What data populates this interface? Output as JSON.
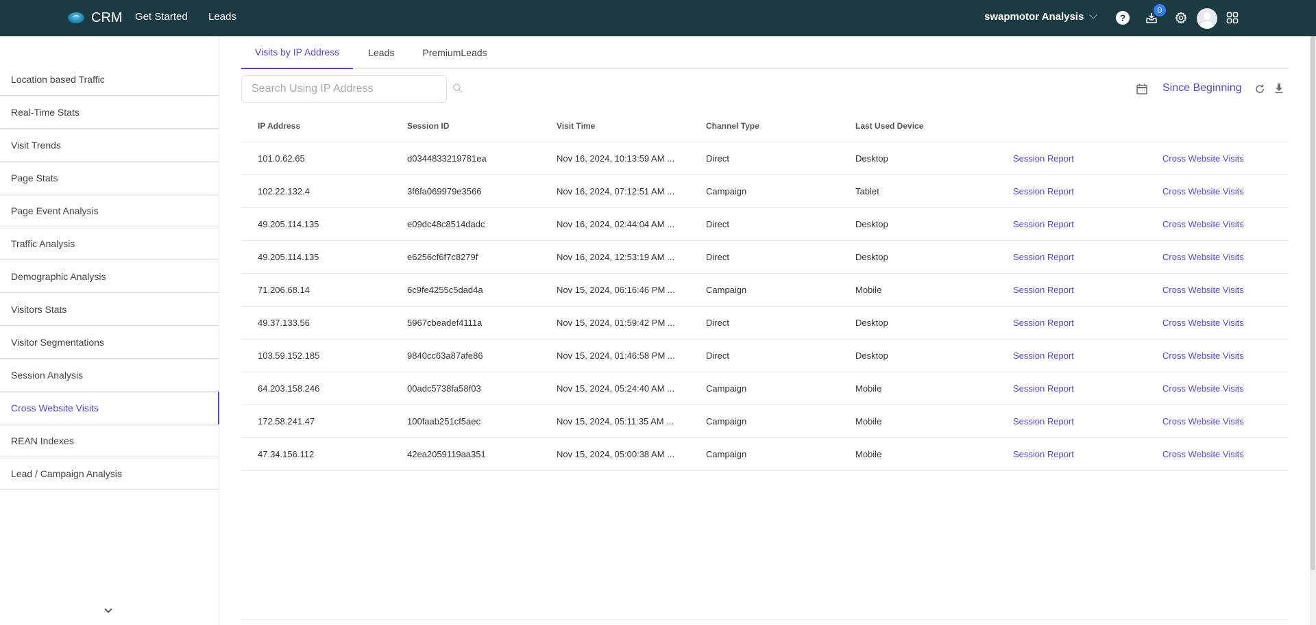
{
  "topbar": {
    "brand": "CRM",
    "nav": [
      "Get Started",
      "Leads"
    ],
    "org_name": "swapmotor Analysis",
    "inbox_count": "0",
    "help_glyph": "?"
  },
  "sidebar": {
    "items": [
      {
        "label": "Location based Traffic",
        "active": false
      },
      {
        "label": "Real-Time Stats",
        "active": false
      },
      {
        "label": "Visit Trends",
        "active": false
      },
      {
        "label": "Page Stats",
        "active": false
      },
      {
        "label": "Page Event Analysis",
        "active": false
      },
      {
        "label": "Traffic Analysis",
        "active": false
      },
      {
        "label": "Demographic Analysis",
        "active": false
      },
      {
        "label": "Visitors Stats",
        "active": false
      },
      {
        "label": "Visitor Segmentations",
        "active": false
      },
      {
        "label": "Session Analysis",
        "active": false
      },
      {
        "label": "Cross Website Visits",
        "active": true
      },
      {
        "label": "REAN Indexes",
        "active": false
      },
      {
        "label": "Lead / Campaign Analysis",
        "active": false
      }
    ]
  },
  "tabs": [
    {
      "label": "Visits by IP Address",
      "active": true
    },
    {
      "label": "Leads",
      "active": false
    },
    {
      "label": "PremiumLeads",
      "active": false
    }
  ],
  "search": {
    "placeholder": "Search Using IP Address",
    "value": ""
  },
  "toolbar": {
    "date_range": "Since Beginning"
  },
  "table": {
    "headers": [
      "IP Address",
      "Session ID",
      "Visit Time",
      "Channel Type",
      "Last Used Device",
      "",
      ""
    ],
    "rows": [
      {
        "ip": "101.0.62.65",
        "session": "d0344833219781ea",
        "time": "Nov 16, 2024, 10:13:59 AM ...",
        "channel": "Direct",
        "device": "Desktop",
        "report": "Session Report",
        "cross": "Cross Website Visits"
      },
      {
        "ip": "102.22.132.4",
        "session": "3f6fa069979e3566",
        "time": "Nov 16, 2024, 07:12:51 AM ...",
        "channel": "Campaign",
        "device": "Tablet",
        "report": "Session Report",
        "cross": "Cross Website Visits"
      },
      {
        "ip": "49.205.114.135",
        "session": "e09dc48c8514dadc",
        "time": "Nov 16, 2024, 02:44:04 AM ...",
        "channel": "Direct",
        "device": "Desktop",
        "report": "Session Report",
        "cross": "Cross Website Visits"
      },
      {
        "ip": "49.205.114.135",
        "session": "e6256cf6f7c8279f",
        "time": "Nov 16, 2024, 12:53:19 AM ...",
        "channel": "Direct",
        "device": "Desktop",
        "report": "Session Report",
        "cross": "Cross Website Visits"
      },
      {
        "ip": "71.206.68.14",
        "session": "6c9fe4255c5dad4a",
        "time": "Nov 15, 2024, 06:16:46 PM ...",
        "channel": "Campaign",
        "device": "Mobile",
        "report": "Session Report",
        "cross": "Cross Website Visits"
      },
      {
        "ip": "49.37.133.56",
        "session": "5967cbeadef4111a",
        "time": "Nov 15, 2024, 01:59:42 PM ...",
        "channel": "Direct",
        "device": "Desktop",
        "report": "Session Report",
        "cross": "Cross Website Visits"
      },
      {
        "ip": "103.59.152.185",
        "session": "9840cc63a87afe86",
        "time": "Nov 15, 2024, 01:46:58 PM ...",
        "channel": "Direct",
        "device": "Desktop",
        "report": "Session Report",
        "cross": "Cross Website Visits"
      },
      {
        "ip": "64.203.158.246",
        "session": "00adc5738fa58f03",
        "time": "Nov 15, 2024, 05:24:40 AM ...",
        "channel": "Campaign",
        "device": "Mobile",
        "report": "Session Report",
        "cross": "Cross Website Visits"
      },
      {
        "ip": "172.58.241.47",
        "session": "100faab251cf5aec",
        "time": "Nov 15, 2024, 05:11:35 AM ...",
        "channel": "Campaign",
        "device": "Mobile",
        "report": "Session Report",
        "cross": "Cross Website Visits"
      },
      {
        "ip": "47.34.156.112",
        "session": "42ea2059119aa351",
        "time": "Nov 15, 2024, 05:00:38 AM ...",
        "channel": "Campaign",
        "device": "Mobile",
        "report": "Session Report",
        "cross": "Cross Website Visits"
      }
    ]
  },
  "colors": {
    "topbar": "#1b3a41",
    "accent": "#5046e5",
    "badge": "#2d7ff9"
  }
}
